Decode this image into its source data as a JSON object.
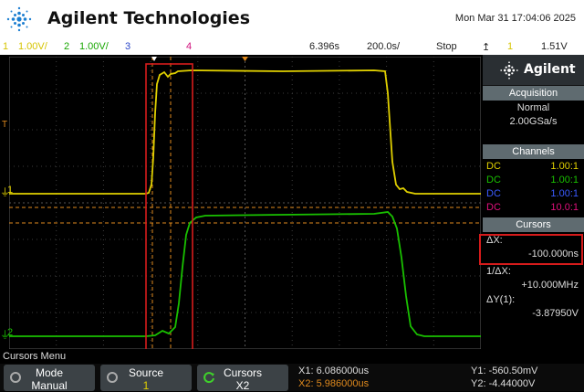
{
  "header": {
    "brand": "Agilent Technologies",
    "datetime": "Mon Mar 31 17:04:06 2025"
  },
  "status": {
    "ch1_num": "1",
    "ch1_scale": "1.00V/",
    "ch2_num": "2",
    "ch2_scale": "1.00V/",
    "ch3_num": "3",
    "ch4_num": "4",
    "time_offset": "6.396s",
    "timebase": "200.0s/",
    "run_state": "Stop",
    "trig_channel": "1",
    "trig_level": "1.51V"
  },
  "panel": {
    "brand": "Agilent",
    "acquisition_title": "Acquisition",
    "acq_mode": "Normal",
    "sample_rate": "2.00GSa/s",
    "channels_title": "Channels",
    "channels": [
      {
        "coupling": "DC",
        "probe": "1.00:1",
        "color": "#e0d000"
      },
      {
        "coupling": "DC",
        "probe": "1.00:1",
        "color": "#19c000"
      },
      {
        "coupling": "DC",
        "probe": "1.00:1",
        "color": "#3a5bff"
      },
      {
        "coupling": "DC",
        "probe": "10.0:1",
        "color": "#e0107c"
      }
    ],
    "cursors_title": "Cursors",
    "dx_label": "ΔX:",
    "dx_value": "-100.000ns",
    "inv_dx_label": "1/ΔX:",
    "inv_dx_value": "+10.000MHz",
    "dy_label": "ΔY(1):",
    "dy_value": "-3.87950V"
  },
  "screen": {
    "trace1_marker": "1",
    "trace2_marker": "2",
    "trigger_marker": "T"
  },
  "menu": {
    "label": "Cursors Menu",
    "keys": [
      {
        "title": "Mode",
        "value": "Manual"
      },
      {
        "title": "Source",
        "value": "1"
      },
      {
        "title": "Cursors",
        "value": "X2"
      }
    ],
    "x1": "X1: 6.086000us",
    "x2": "X2: 5.986000us",
    "y1": "Y1: -560.50mV",
    "y2": "Y2: -4.44000V"
  },
  "colors": {
    "ch1": "#e0d000",
    "ch2": "#19c000",
    "cursor": "#e08a1e",
    "highlight": "#d61b1b"
  }
}
